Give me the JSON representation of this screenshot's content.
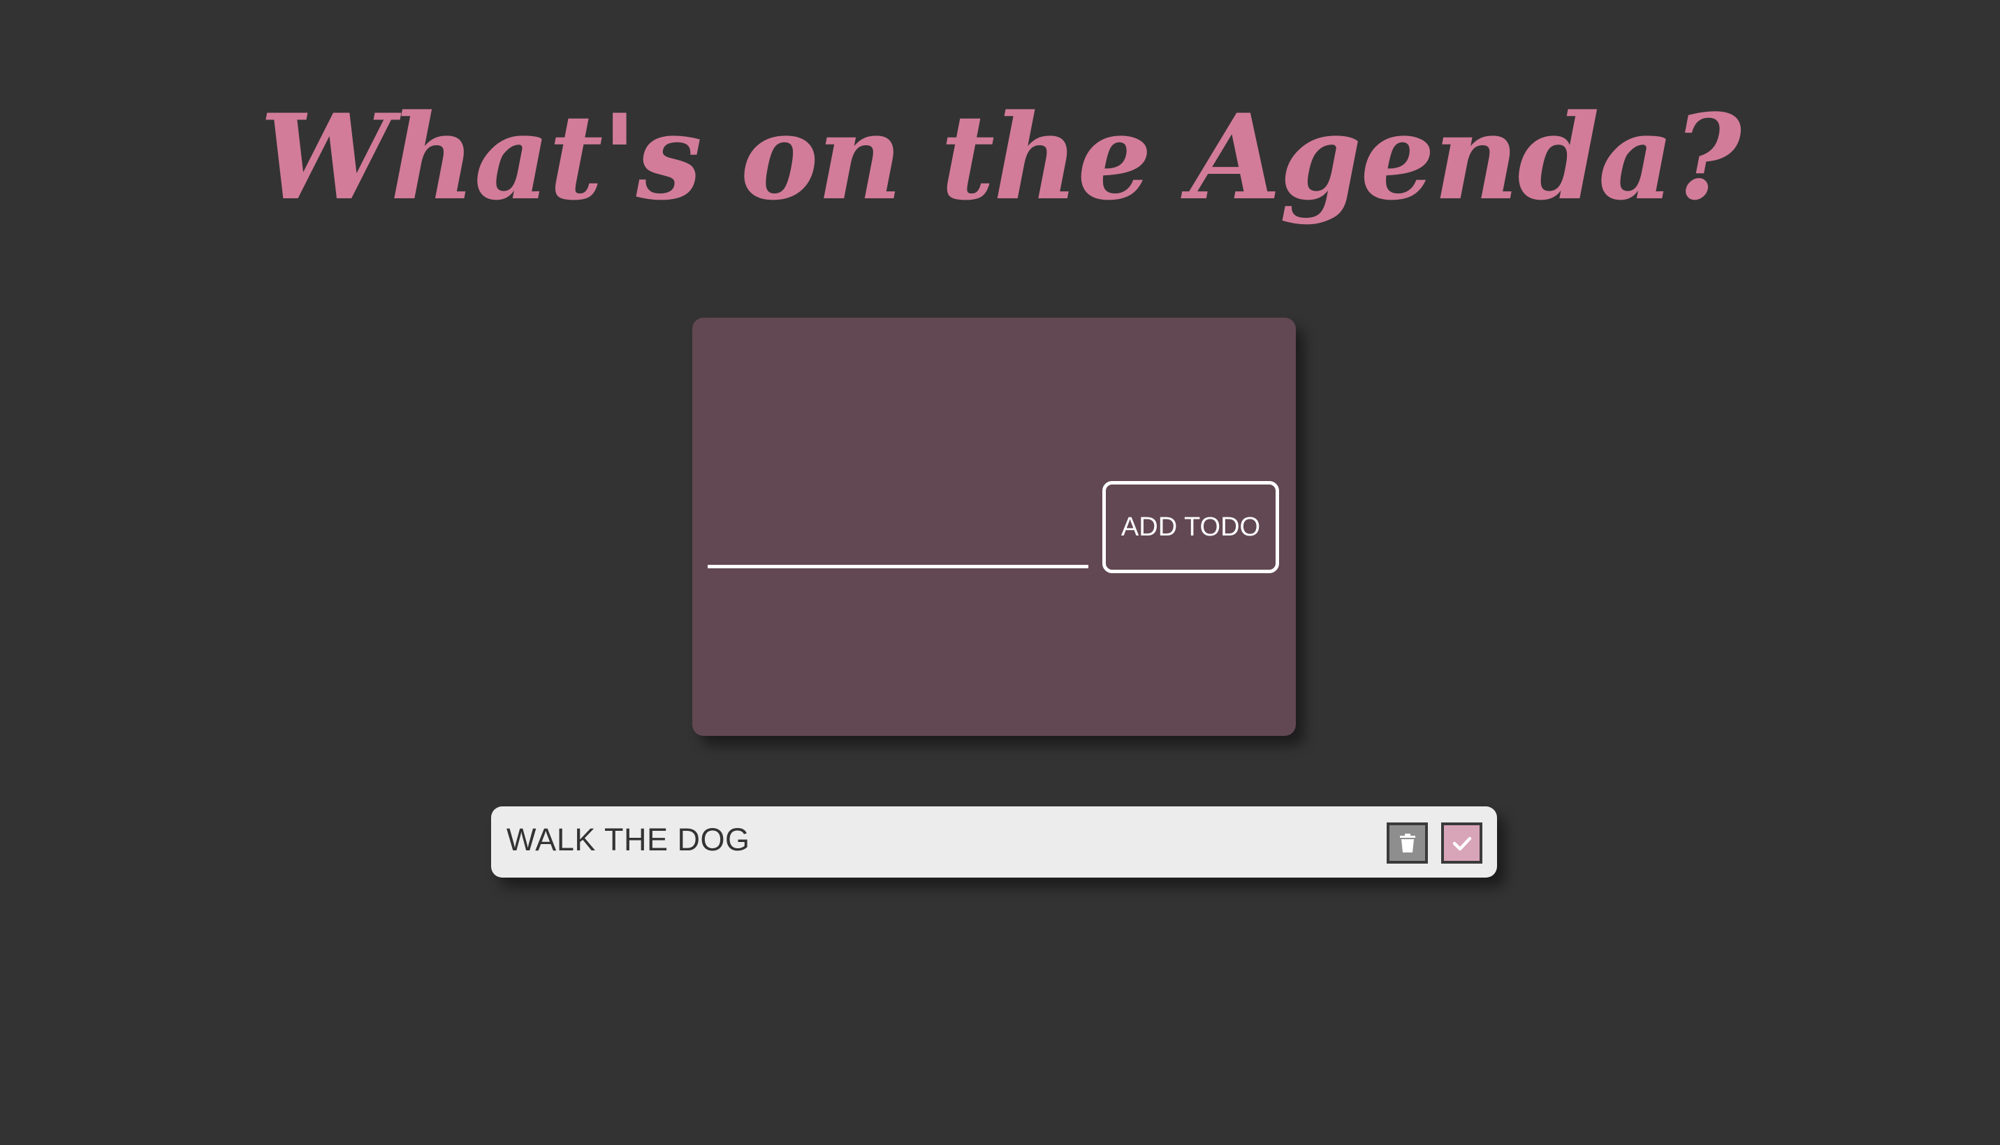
{
  "header": {
    "title": "What's on the Agenda?"
  },
  "form": {
    "input_value": "",
    "input_placeholder": "",
    "add_button_label": "ADD TODO"
  },
  "todos": [
    {
      "text": "WALK THE DOG",
      "delete_icon": "trash-icon",
      "complete_icon": "check-icon"
    }
  ],
  "colors": {
    "background": "#333333",
    "accent": "#d27c9a",
    "card": "#624852",
    "item": "#ececec",
    "delete_button": "#8e8e8e",
    "complete_button": "#d8a4b8"
  }
}
